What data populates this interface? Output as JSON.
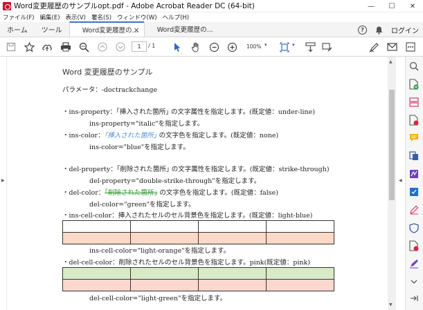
{
  "window": {
    "title": "Word変更履歴のサンプルopt.pdf - Adobe Acrobat Reader DC (64-bit)",
    "controls": {
      "minimize": "—",
      "maximize": "☐",
      "close": "✕"
    }
  },
  "menu": [
    "ファイル(F)",
    "編集(E)",
    "表示(V)",
    "署名(S)",
    "ウィンドウ(W)",
    "ヘルプ(H)"
  ],
  "tabs": {
    "home": "ホーム",
    "tools": "ツール",
    "documents": [
      {
        "label": "Word変更履歴の...",
        "active": true,
        "close": "×"
      },
      {
        "label": "Word変更履歴の...",
        "active": false
      }
    ],
    "login": "ログイン"
  },
  "toolbar": {
    "current_page": "1",
    "total_pages": "/ 1",
    "zoom": "100%"
  },
  "document": {
    "title": "Word 変更履歴のサンプル",
    "param": "パラメータ：-doctrackchange",
    "ins_property": {
      "line1": "・ins-property：｢挿入された箇所｣ の文字属性を指定します。(既定値：under-line)",
      "line2": "ins-property=\"italic\"を指定します。"
    },
    "ins_color": {
      "prefix": "・ins-color：",
      "inserted": "｢挿入された箇所｣",
      "suffix": " の文字色を指定します。(既定値：none)",
      "line2": "ins-color=\"blue\"を指定します。"
    },
    "del_property": {
      "line1": "・del-property：｢削除された箇所｣ の文字属性を指定します。(既定値：strike-through)",
      "line2": "del-property=\"double-strike-through\"を指定します。"
    },
    "del_color": {
      "prefix": "・del-color：",
      "deleted": "｢削除された箇所｣",
      "suffix": " の文字色を指定します。(既定値：false)",
      "line2": "del-color=\"green\"を指定します。"
    },
    "ins_cell": {
      "line1": "・ins-cell-color：挿入されたセルのセル背景色を指定します。(既定値：light-blue)",
      "line2": "ins-cell-color=\"light-orange\"を指定します。"
    },
    "del_cell": {
      "line1": "・del-cell-color：削除されたセルのセル背景色を指定します。pink(既定値：pink)",
      "line2": "del-cell-color=\"light-green\"を指定します。"
    }
  },
  "colors": {
    "inserted_text": "#4d8fd6",
    "deleted_text": "#2e9a2e",
    "light_orange": "#fbd9c6",
    "light_green": "#d8ebc6",
    "pink": "#fbd7d0",
    "tab_accent": "#3b73c6"
  }
}
